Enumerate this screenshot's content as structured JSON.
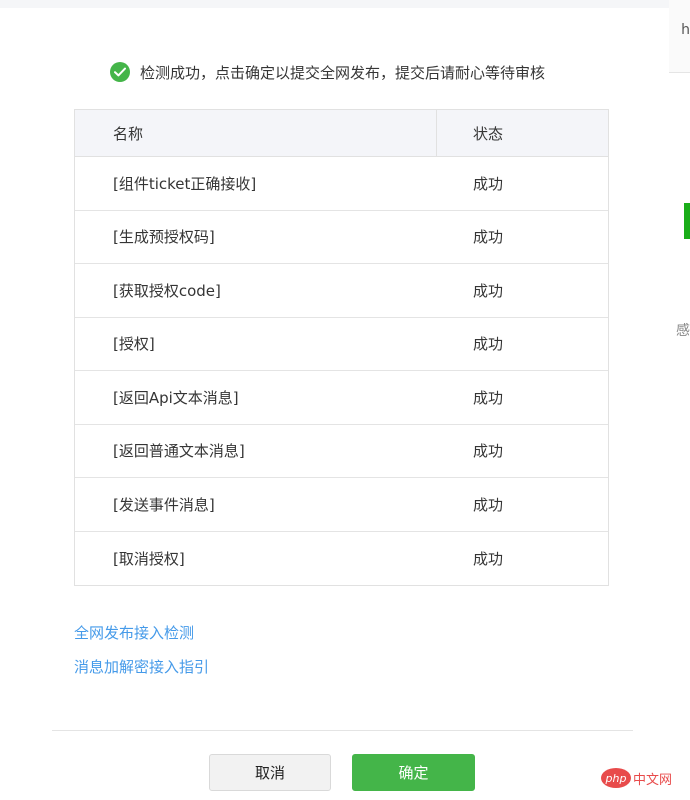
{
  "notice": {
    "text": "检测成功，点击确定以提交全网发布，提交后请耐心等待审核",
    "icon": "check-circle-icon",
    "icon_color": "#44b549"
  },
  "table": {
    "headers": {
      "name": "名称",
      "status": "状态"
    },
    "rows": [
      {
        "name": "[组件ticket正确接收]",
        "status": "成功"
      },
      {
        "name": "[生成预授权码]",
        "status": "成功"
      },
      {
        "name": "[获取授权code]",
        "status": "成功"
      },
      {
        "name": "[授权]",
        "status": "成功"
      },
      {
        "name": "[返回Api文本消息]",
        "status": "成功"
      },
      {
        "name": "[返回普通文本消息]",
        "status": "成功"
      },
      {
        "name": "[发送事件消息]",
        "status": "成功"
      },
      {
        "name": "[取消授权]",
        "status": "成功"
      }
    ]
  },
  "links": {
    "detection": "全网发布接入检测",
    "encryption_guide": "消息加解密接入指引",
    "color": "#459ae9"
  },
  "buttons": {
    "cancel": "取消",
    "confirm": "确定",
    "confirm_color": "#44b549"
  },
  "watermark": {
    "logo_text": "php",
    "text": "中文网"
  },
  "edge": {
    "glyph_top": "h",
    "glyph_mid": "感"
  }
}
